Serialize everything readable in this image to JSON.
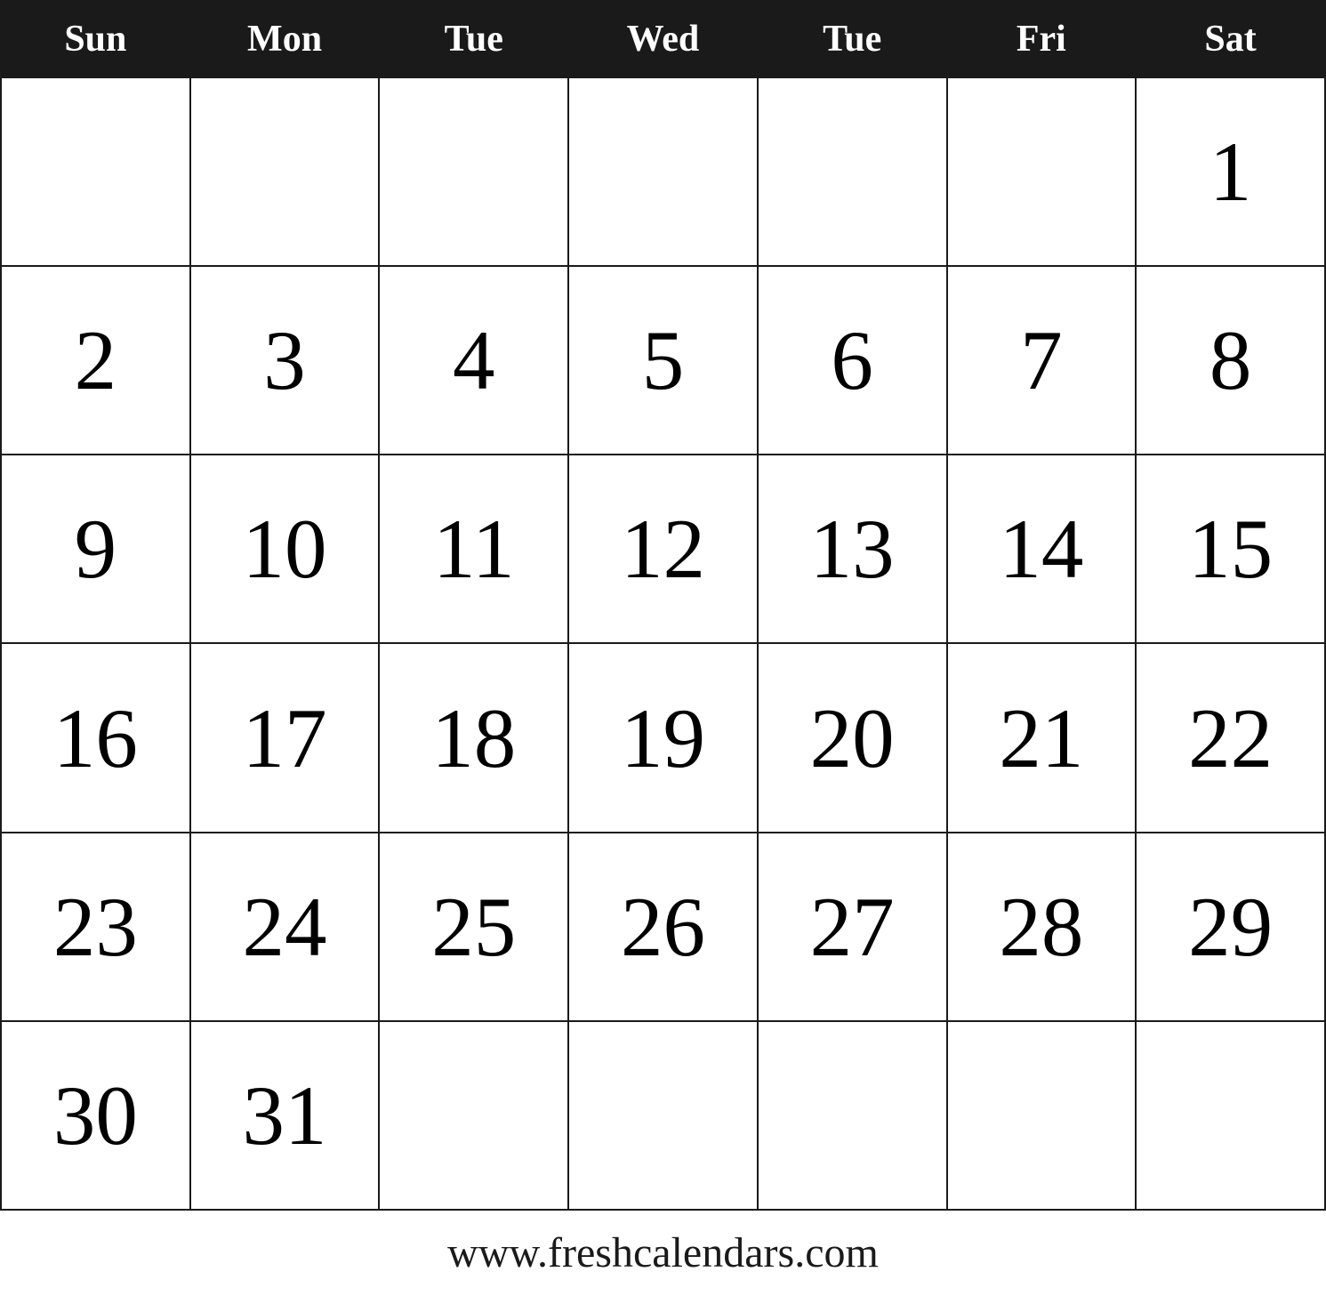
{
  "header": {
    "days": [
      "Sun",
      "Mon",
      "Tue",
      "Wed",
      "Tue",
      "Fri",
      "Sat"
    ]
  },
  "rows": [
    [
      "",
      "",
      "",
      "",
      "",
      "",
      "1"
    ],
    [
      "2",
      "3",
      "4",
      "5",
      "6",
      "7",
      "8"
    ],
    [
      "9",
      "10",
      "11",
      "12",
      "13",
      "14",
      "15"
    ],
    [
      "16",
      "17",
      "18",
      "19",
      "20",
      "21",
      "22"
    ],
    [
      "23",
      "24",
      "25",
      "26",
      "27",
      "28",
      "29"
    ],
    [
      "30",
      "31",
      "",
      "",
      "",
      "",
      ""
    ]
  ],
  "footer": {
    "text": "www.freshcalendars.com"
  }
}
